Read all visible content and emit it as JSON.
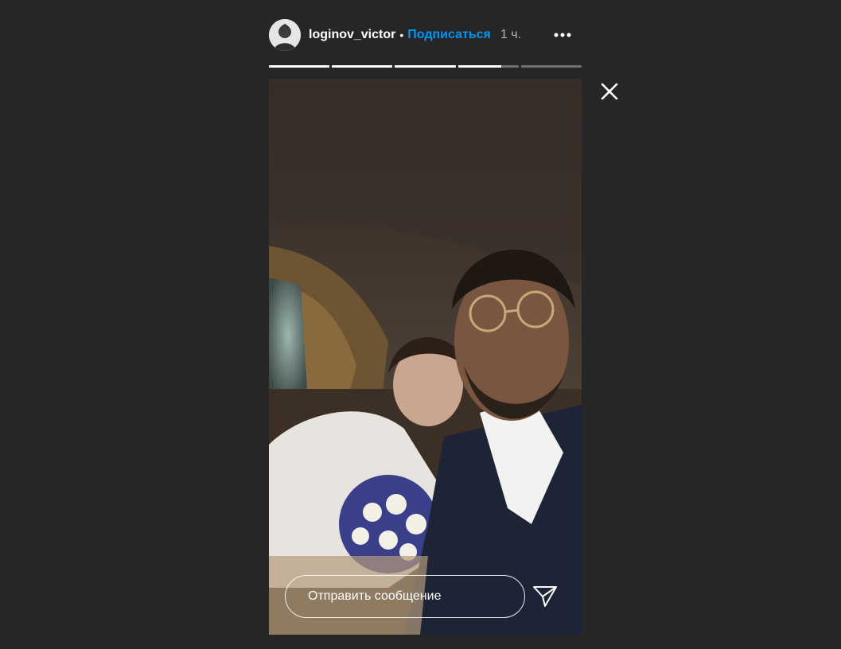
{
  "header": {
    "username": "loginov_victor",
    "separator": "•",
    "follow_label": "Подписаться",
    "time_ago": "1 ч.",
    "avatar_icon": "avatar-icon",
    "more_icon": "more-options-icon"
  },
  "progress": {
    "segments": [
      1.0,
      1.0,
      1.0,
      0.72,
      0.0
    ]
  },
  "reply": {
    "placeholder": "Отправить сообщение",
    "send_icon": "send-icon"
  },
  "colors": {
    "background": "#262626",
    "follow": "#0095f6",
    "text": "#ffffff",
    "muted": "#b5b5b5"
  },
  "close_icon": "close-icon"
}
